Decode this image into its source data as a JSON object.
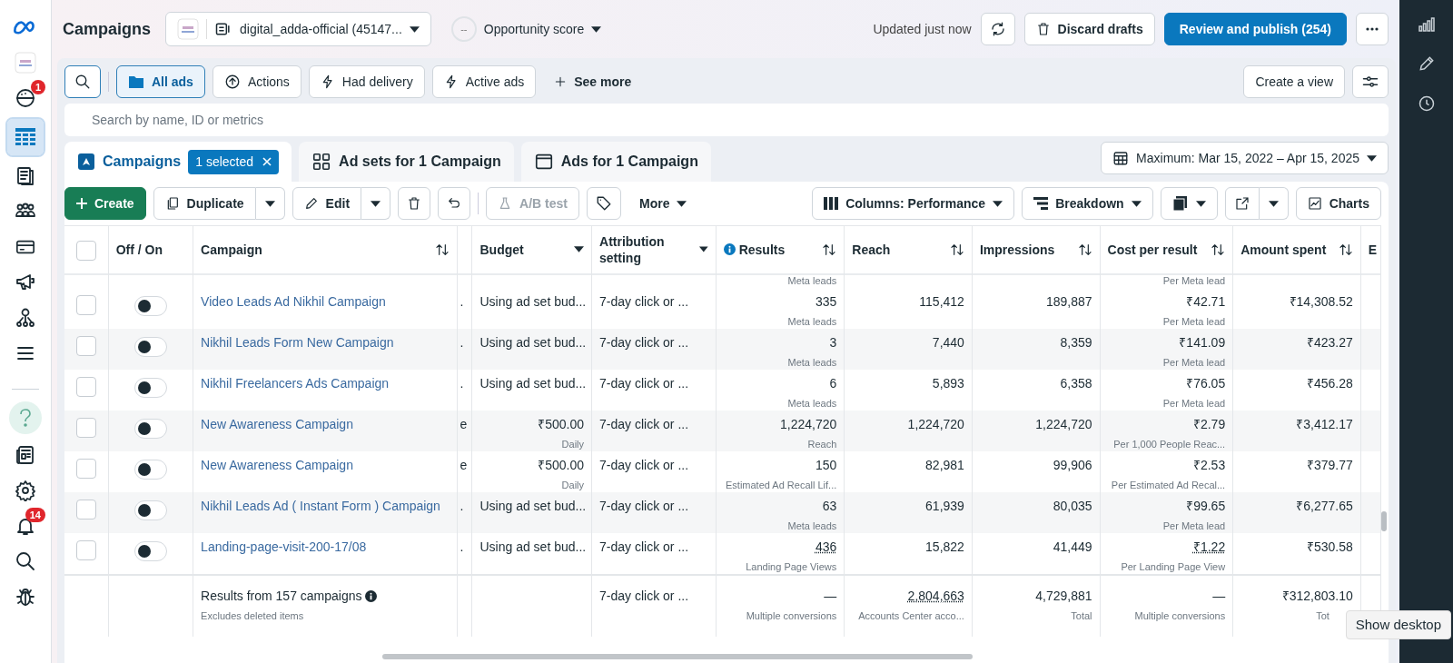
{
  "sidebar": {
    "items": [
      {
        "kind": "logo",
        "selected": false
      },
      {
        "kind": "account",
        "selected": false
      },
      {
        "kind": "emoji",
        "selected": false,
        "badge": "1"
      },
      {
        "kind": "table",
        "selected": true
      },
      {
        "kind": "pages",
        "selected": false
      },
      {
        "kind": "people",
        "selected": false
      },
      {
        "kind": "card",
        "selected": false
      },
      {
        "kind": "megaphone",
        "selected": false
      },
      {
        "kind": "network",
        "selected": false
      },
      {
        "kind": "menu",
        "selected": false
      },
      {
        "kind": "divider"
      },
      {
        "kind": "help",
        "selected": false
      },
      {
        "kind": "news",
        "selected": false
      },
      {
        "kind": "settings",
        "selected": false
      },
      {
        "kind": "bell",
        "selected": false,
        "badge": "14"
      },
      {
        "kind": "search",
        "selected": false
      },
      {
        "kind": "bug",
        "selected": false
      }
    ]
  },
  "rail": {
    "items": [
      {
        "kind": "chart"
      },
      {
        "kind": "pencil"
      },
      {
        "kind": "clock"
      }
    ]
  },
  "header": {
    "title": "Campaigns",
    "account": "digital_adda-official (45147...",
    "opportunity_score": "--",
    "opportunity_label": "Opportunity score",
    "updated": "Updated just now",
    "discard": "Discard drafts",
    "publish": "Review and publish (254)"
  },
  "filters": {
    "chips": [
      {
        "label": "All ads",
        "kind": "folder",
        "selected": true
      },
      {
        "label": "Actions",
        "kind": "upload",
        "selected": false
      },
      {
        "label": "Had delivery",
        "kind": "bolt",
        "selected": false
      },
      {
        "label": "Active ads",
        "kind": "bolt",
        "selected": false
      }
    ],
    "see_more": "See more",
    "create_view": "Create a view"
  },
  "search": {
    "placeholder": "Search by name, ID or metrics"
  },
  "tabs": [
    {
      "label": "Campaigns",
      "kind": "campaigns",
      "selected": true,
      "badge": "1 selected"
    },
    {
      "label": "Ad sets for 1 Campaign",
      "kind": "adsets",
      "selected": false
    },
    {
      "label": "Ads for 1 Campaign",
      "kind": "ads",
      "selected": false
    }
  ],
  "date_range": "Maximum: Mar 15, 2022 – Apr 15, 2025",
  "toolbar": {
    "create": "Create",
    "duplicate": "Duplicate",
    "edit": "Edit",
    "ab_test": {
      "label": "A/B test",
      "disabled": true
    },
    "more": "More",
    "columns": "Columns: Performance",
    "breakdown": "Breakdown",
    "charts": "Charts"
  },
  "table": {
    "columns": [
      {
        "kind": "check"
      },
      {
        "label": "Off / On",
        "kind": "plain"
      },
      {
        "label": "Campaign",
        "kind": "sort"
      },
      {
        "kind": "caret"
      },
      {
        "label": "Budget",
        "kind": "caret"
      },
      {
        "label": "Attribution setting",
        "kind": "caret"
      },
      {
        "label": "Results",
        "kind": "sort",
        "info": true
      },
      {
        "label": "Reach",
        "kind": "sort"
      },
      {
        "label": "Impressions",
        "kind": "sort"
      },
      {
        "label": "Cost per result",
        "kind": "sort"
      },
      {
        "label": "Amount spent",
        "kind": "sort"
      },
      {
        "label": "E",
        "kind": "plain"
      }
    ],
    "select_all": {
      "checked": false
    },
    "partial_row": {
      "results_sub": "Meta leads",
      "cost_sub": "Per Meta lead"
    },
    "rows": [
      {
        "selected": false,
        "on": false,
        "campaign": "Video Leads Ad Nikhil Campaign",
        "column_4": ".",
        "budget": "Using ad set bud...",
        "attribution": "7-day click or ...",
        "results": "335",
        "results_sub": "Meta leads",
        "reach": "115,412",
        "impressions": "189,887",
        "cost": "₹42.71",
        "cost_sub": "Per Meta lead",
        "spent": "₹14,308.52"
      },
      {
        "selected": false,
        "on": false,
        "campaign": "Nikhil Leads Form New Campaign",
        "column_4": ".",
        "budget": "Using ad set bud...",
        "attribution": "7-day click or ...",
        "results": "3",
        "results_sub": "Meta leads",
        "reach": "7,440",
        "impressions": "8,359",
        "cost": "₹141.09",
        "cost_sub": "Per Meta lead",
        "spent": "₹423.27"
      },
      {
        "selected": false,
        "on": false,
        "campaign": "Nikhil Freelancers Ads Campaign",
        "column_4": ".",
        "budget": "Using ad set bud...",
        "attribution": "7-day click or ...",
        "results": "6",
        "results_sub": "Meta leads",
        "reach": "5,893",
        "impressions": "6,358",
        "cost": "₹76.05",
        "cost_sub": "Per Meta lead",
        "spent": "₹456.28"
      },
      {
        "selected": false,
        "on": false,
        "campaign": "New Awareness Campaign",
        "column_4": "e",
        "budget": "₹500.00",
        "budget_sub": "Daily",
        "attribution": "7-day click or ...",
        "results": "1,224,720",
        "results_sub": "Reach",
        "reach": "1,224,720",
        "impressions": "1,224,720",
        "cost": "₹2.79",
        "cost_sub": "Per 1,000 People Reac...",
        "spent": "₹3,412.17"
      },
      {
        "selected": false,
        "on": false,
        "campaign": "New Awareness Campaign",
        "column_4": "e",
        "budget": "₹500.00",
        "budget_sub": "Daily",
        "attribution": "7-day click or ...",
        "results": "150",
        "results_sub": "Estimated Ad Recall Lif...",
        "reach": "82,981",
        "impressions": "99,906",
        "cost": "₹2.53",
        "cost_sub": "Per Estimated Ad Recal...",
        "spent": "₹379.77"
      },
      {
        "selected": false,
        "on": false,
        "campaign": "Nikhil Leads Ad ( Instant Form ) Campaign",
        "column_4": ".",
        "budget": "Using ad set bud...",
        "attribution": "7-day click or ...",
        "results": "63",
        "results_sub": "Meta leads",
        "reach": "61,939",
        "impressions": "80,035",
        "cost": "₹99.65",
        "cost_sub": "Per Meta lead",
        "spent": "₹6,277.65"
      },
      {
        "selected": false,
        "on": false,
        "campaign": "Landing-page-visit-200-17/08",
        "column_4": ".",
        "budget": "Using ad set bud...",
        "attribution": "7-day click or ...",
        "results": "436",
        "results_sub": "Landing Page Views",
        "reach": "15,822",
        "impressions": "41,449",
        "cost": "₹1.22",
        "cost_sub": "Per Landing Page View",
        "spent": "₹530.58"
      }
    ],
    "footer": {
      "campaign": "Results from 157 campaigns",
      "campaign_sub": "Excludes deleted items",
      "attribution": "7-day click or ...",
      "results": "—",
      "results_sub": "Multiple conversions",
      "reach": "2,804,663",
      "reach_sub": "Accounts Center acco...",
      "impressions": "4,729,881",
      "impressions_sub": "Total",
      "cost": "—",
      "cost_sub": "Multiple conversions",
      "spent": "₹312,803.10",
      "spent_sub": "Tot"
    }
  },
  "tooltip": "Show desktop"
}
